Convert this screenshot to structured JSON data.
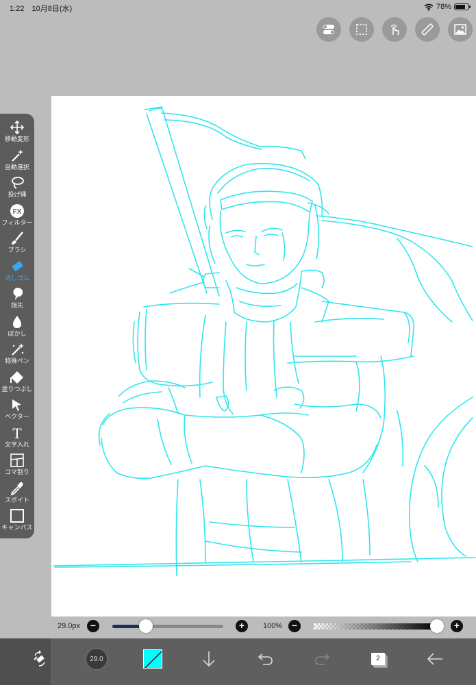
{
  "status": {
    "time": "1:22",
    "date": "10月8日(水)",
    "battery_text": "78%",
    "battery_level": 0.78
  },
  "top_tools": [
    {
      "icon": "toggle-icon"
    },
    {
      "icon": "selection-icon"
    },
    {
      "icon": "gesture-icon"
    },
    {
      "icon": "ruler-icon"
    },
    {
      "icon": "image-icon"
    }
  ],
  "tools": [
    {
      "label": "移動変形",
      "icon": "move-icon"
    },
    {
      "label": "自動選択",
      "icon": "magic-wand-icon"
    },
    {
      "label": "投げ縄",
      "icon": "lasso-icon"
    },
    {
      "label": "フィルター",
      "icon": "fx-icon",
      "glyph": "FX"
    },
    {
      "label": "ブラシ",
      "icon": "brush-icon"
    },
    {
      "label": "消しゴム",
      "icon": "eraser-icon",
      "active": true
    },
    {
      "label": "指先",
      "icon": "smudge-icon"
    },
    {
      "label": "ぼかし",
      "icon": "blur-icon"
    },
    {
      "label": "特殊ペン",
      "icon": "special-pen-icon"
    },
    {
      "label": "塗りつぶし",
      "icon": "fill-icon"
    },
    {
      "label": "ベクター",
      "icon": "vector-icon"
    },
    {
      "label": "文字入れ",
      "icon": "text-icon",
      "glyph": "T"
    },
    {
      "label": "コマ割り",
      "icon": "frame-divider-icon"
    },
    {
      "label": "スポイト",
      "icon": "eyedropper-icon"
    },
    {
      "label": "キャンバス",
      "icon": "canvas-icon"
    }
  ],
  "brush": {
    "size_label": "29.0px",
    "size_fraction": 0.3,
    "opacity_label": "100%",
    "opacity_fraction": 1.0,
    "preview_label": "29.0"
  },
  "bottom_bar": {
    "color": "#00ffff",
    "layer_count": "2"
  },
  "colors": {
    "sketch_line": "#2ee6ee",
    "active_tool": "#38a8f0"
  }
}
